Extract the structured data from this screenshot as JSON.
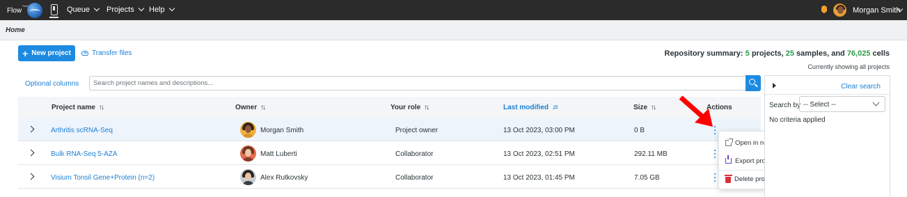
{
  "app": {
    "brand_tagline": "Partek",
    "brand_name": "Flow",
    "nav": [
      {
        "label": "Queue"
      },
      {
        "label": "Projects"
      },
      {
        "label": "Help"
      }
    ],
    "user_name": "Morgan Smith"
  },
  "breadcrumb": "Home",
  "toolbar": {
    "new_project_label": "New project",
    "transfer_label": "Transfer files"
  },
  "summary": {
    "prefix": "Repository summary: ",
    "projects_count": "5",
    "projects_word": " projects, ",
    "samples_count": "25",
    "samples_word": " samples, and ",
    "cells_count": "76,025",
    "cells_word": " cells",
    "currently_showing": "Currently showing all projects"
  },
  "search": {
    "optional_columns_label": "Optional columns",
    "placeholder": "Search project names and descriptions..."
  },
  "table": {
    "headers": {
      "name": "Project name",
      "owner": "Owner",
      "role": "Your role",
      "modified": "Last modified",
      "size": "Size",
      "actions": "Actions"
    },
    "sort_icon": "↑↓",
    "sorted_icon": "↓≡",
    "rows": [
      {
        "name": "Arthritis scRNA-Seq",
        "owner": "Morgan Smith",
        "role": "Project owner",
        "modified": "13 Oct 2023, 03:00 PM",
        "size": "0 B"
      },
      {
        "name": "Bulk RNA-Seq 5-AZA",
        "owner": "Matt Luberti",
        "role": "Collaborator",
        "modified": "13 Oct 2023, 02:51 PM",
        "size": "292.11 MB"
      },
      {
        "name": "Visium Tonsil Gene+Protein (n=2)",
        "owner": "Alex Rutkovsky",
        "role": "Collaborator",
        "modified": "13 Oct 2023, 01:45 PM",
        "size": "7.05 GB"
      }
    ]
  },
  "row_menu": {
    "items": [
      {
        "label": "Open in new tab",
        "icon": "external-link-icon"
      },
      {
        "label": "Export project",
        "icon": "export-icon"
      },
      {
        "label": "Delete project",
        "icon": "trash-icon"
      }
    ]
  },
  "filter_panel": {
    "clear_search_label": "Clear search",
    "search_by_label": "Search by",
    "select_value": "-- Select --",
    "no_criteria": "No criteria applied"
  },
  "colors": {
    "accent": "#1d8ae0",
    "link": "#1d7fd4",
    "count_green": "#2e9c4a",
    "annotation_red": "#ff0000",
    "delete_red": "#d8313b",
    "topbar": "#2b2b2b"
  }
}
